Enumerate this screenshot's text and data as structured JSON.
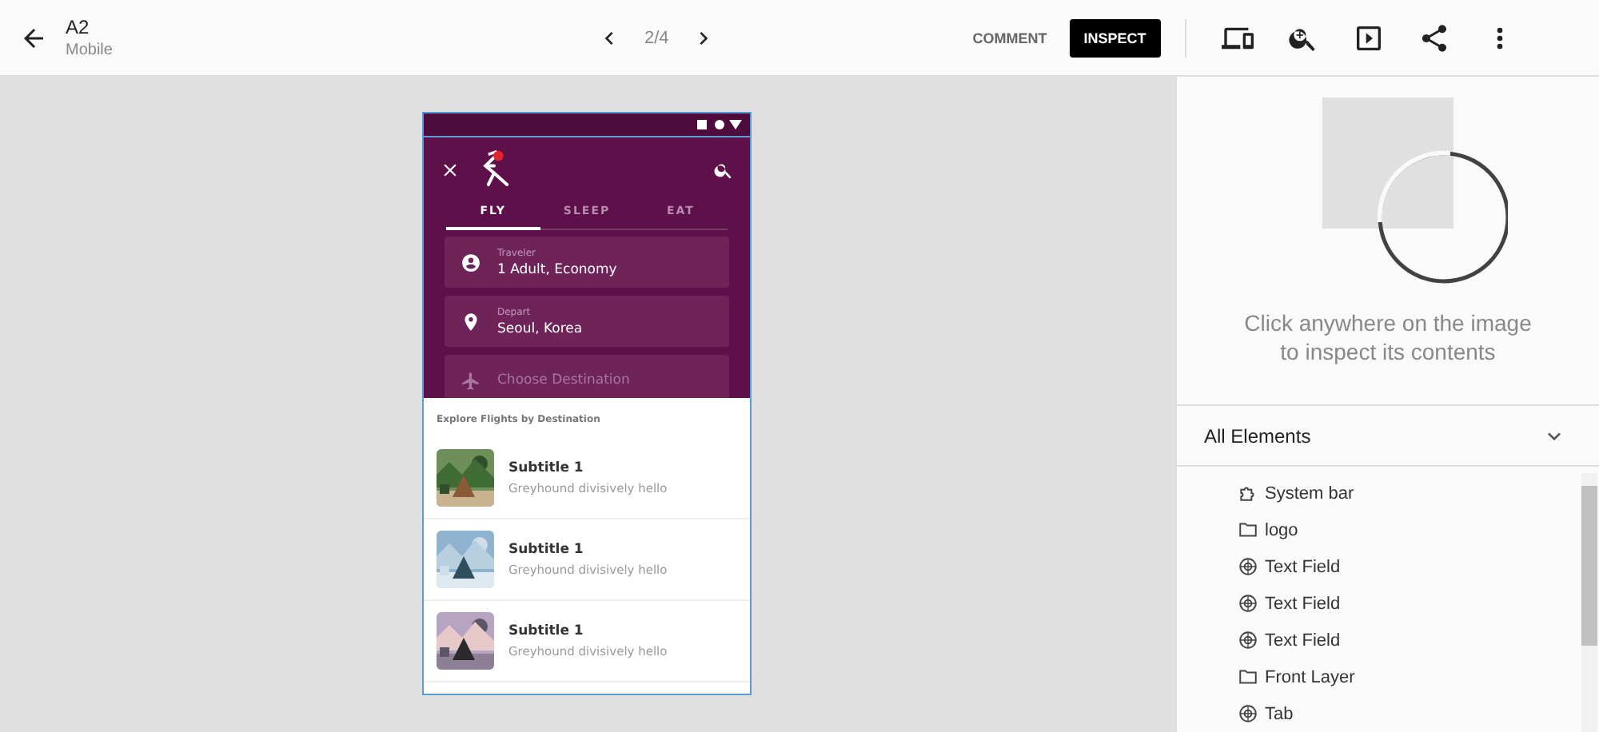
{
  "toolbar": {
    "title": "A2",
    "subtitle": "Mobile",
    "pager": "2/4",
    "comment": "COMMENT",
    "inspect": "INSPECT"
  },
  "phone": {
    "tabs": [
      {
        "label": "FLY",
        "selected": true
      },
      {
        "label": "SLEEP",
        "selected": false
      },
      {
        "label": "EAT",
        "selected": false
      }
    ],
    "fields": [
      {
        "kind": "person",
        "label": "Traveler",
        "value": "1 Adult, Economy"
      },
      {
        "kind": "place",
        "label": "Depart",
        "value": "Seoul, Korea"
      },
      {
        "kind": "plane",
        "placeholder": "Choose Destination"
      }
    ],
    "section_title": "Explore Flights by Destination",
    "items": [
      {
        "title": "Subtitle 1",
        "subtitle": "Greyhound divisively hello"
      },
      {
        "title": "Subtitle 1",
        "subtitle": "Greyhound divisively hello"
      },
      {
        "title": "Subtitle 1",
        "subtitle": "Greyhound divisively hello"
      }
    ]
  },
  "inspector": {
    "hint": "Click anywhere on the image to inspect its contents",
    "elements_title": "All Elements",
    "elements": [
      {
        "kind": "component",
        "label": "System bar"
      },
      {
        "kind": "folder",
        "label": "logo"
      },
      {
        "kind": "symbol",
        "label": "Text Field"
      },
      {
        "kind": "symbol",
        "label": "Text Field"
      },
      {
        "kind": "symbol",
        "label": "Text Field"
      },
      {
        "kind": "folder",
        "label": "Front Layer"
      },
      {
        "kind": "symbol",
        "label": "Tab"
      }
    ]
  }
}
